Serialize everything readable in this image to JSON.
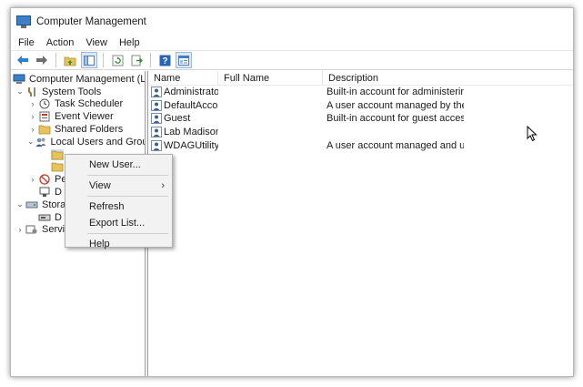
{
  "window": {
    "title": "Computer Management"
  },
  "menubar": [
    "File",
    "Action",
    "View",
    "Help"
  ],
  "toolbar": {
    "buttons": [
      "back-arrow-icon",
      "forward-arrow-icon",
      "up-folder-icon",
      "show-hide-tree-icon",
      "refresh-icon",
      "export-list-icon",
      "help-icon",
      "properties-icon"
    ]
  },
  "tree": {
    "root": "Computer Management (Local",
    "system_tools": "System Tools",
    "task_scheduler": "Task Scheduler",
    "event_viewer": "Event Viewer",
    "shared_folders": "Shared Folders",
    "local_users_groups": "Local Users and Groups",
    "performance": "Pe",
    "device_manager": "D",
    "storage": "Stora",
    "disk_management": "D",
    "services": "Servic"
  },
  "list": {
    "headers": {
      "name": "Name",
      "full_name": "Full Name",
      "description": "Description"
    },
    "rows": [
      {
        "name": "Administrator",
        "full_name": "",
        "description": "Built-in account for administering..."
      },
      {
        "name": "DefaultAcco...",
        "full_name": "",
        "description": "A user account managed by the s..."
      },
      {
        "name": "Guest",
        "full_name": "",
        "description": "Built-in account for guest access t..."
      },
      {
        "name": "Lab Madison",
        "full_name": "",
        "description": ""
      },
      {
        "name": "WDAGUtility...",
        "full_name": "",
        "description": "A user account managed and use..."
      }
    ]
  },
  "context_menu": {
    "new_user": "New User...",
    "view": "View",
    "refresh": "Refresh",
    "export_list": "Export List...",
    "help": "Help"
  },
  "colors": {
    "accent_blue": "#3a7fc8",
    "folder_yellow": "#e8c25a",
    "menu_bg": "#f2f2f2"
  }
}
